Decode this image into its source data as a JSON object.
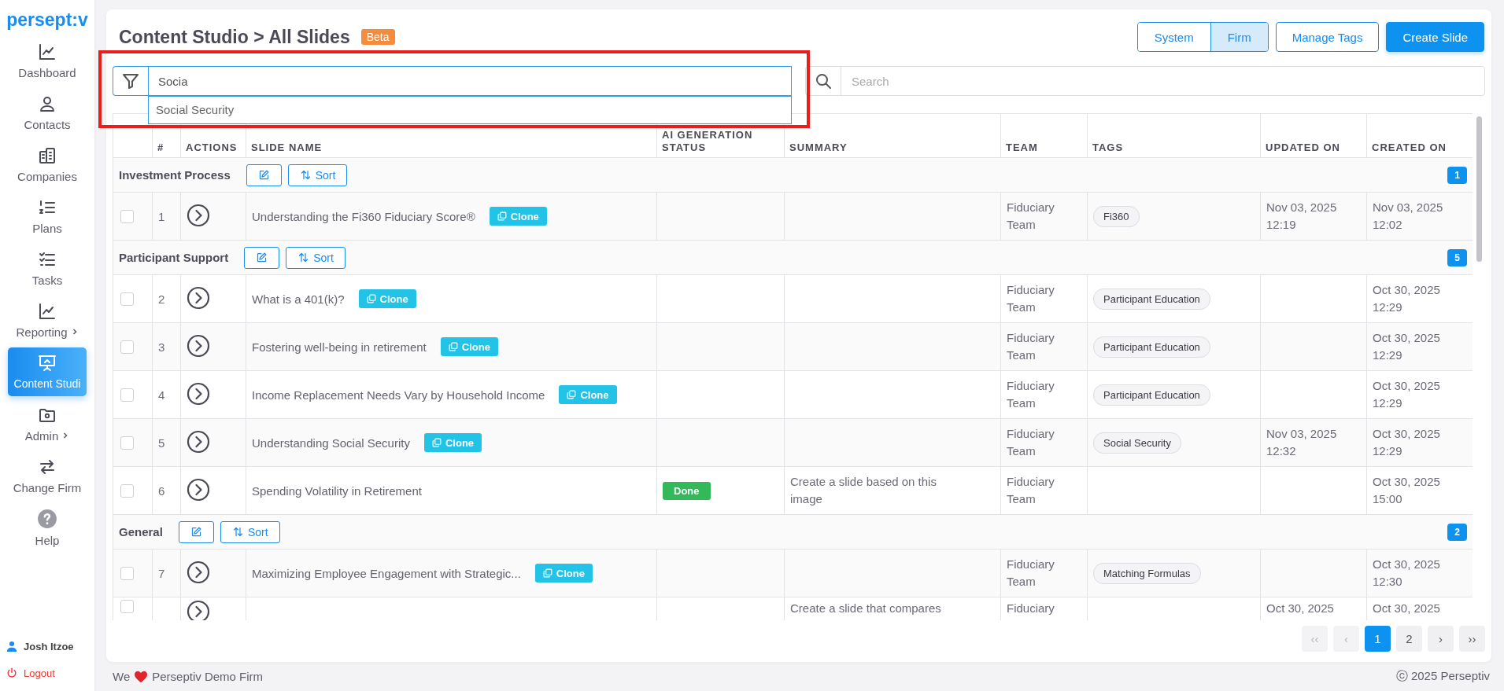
{
  "sidebar": {
    "logo": "persept:v",
    "items": [
      {
        "label": "Dashboard",
        "selected": false,
        "submenu": false
      },
      {
        "label": "Contacts",
        "selected": false,
        "submenu": false
      },
      {
        "label": "Companies",
        "selected": false,
        "submenu": false
      },
      {
        "label": "Plans",
        "selected": false,
        "submenu": false
      },
      {
        "label": "Tasks",
        "selected": false,
        "submenu": false
      },
      {
        "label": "Reporting",
        "selected": false,
        "submenu": true
      },
      {
        "label": "Content Studi",
        "selected": true,
        "submenu": false
      },
      {
        "label": "Admin",
        "selected": false,
        "submenu": true
      },
      {
        "label": "Change Firm",
        "selected": false,
        "submenu": false
      },
      {
        "label": "Help",
        "selected": false,
        "submenu": false
      }
    ],
    "user": "Josh Itzoe",
    "logout": "Logout"
  },
  "header": {
    "title": "Content Studio > All Slides",
    "badge": "Beta",
    "scope_toggle": [
      {
        "label": "System",
        "selected": false
      },
      {
        "label": "Firm",
        "selected": true
      }
    ],
    "buttons": [
      {
        "label": "Manage Tags",
        "kind": "outline"
      },
      {
        "label": "Create Slide",
        "kind": "primary"
      }
    ]
  },
  "filter": {
    "value": "Socia",
    "suggestions": [
      "Social Security"
    ]
  },
  "highlight_box": true,
  "search": {
    "placeholder": "Search"
  },
  "table": {
    "columns": [
      "#",
      "ACTIONS",
      "SLIDE NAME",
      "AI GENERATION STATUS",
      "SUMMARY",
      "TEAM",
      "TAGS",
      "UPDATED ON",
      "CREATED ON"
    ],
    "groups": [
      {
        "name": "Investment Process",
        "sort_label": "Sort",
        "count": "1",
        "rows": [
          {
            "checked": false,
            "number": "1",
            "name": "Understanding the Fi360 Fiduciary Score®",
            "clone": "Clone",
            "team": "Fiduciary Team",
            "tag": "Fi360",
            "updated": "Nov 03, 2025 12:19",
            "created": "Nov 03, 2025 12:02"
          }
        ]
      },
      {
        "name": "Participant Support",
        "sort_label": "Sort",
        "count": "5",
        "rows": [
          {
            "checked": false,
            "number": "2",
            "name": "What is a 401(k)?",
            "clone": "Clone",
            "team": "Fiduciary Team",
            "tag": "Participant Education",
            "created": "Oct 30, 2025 12:29"
          },
          {
            "checked": false,
            "number": "3",
            "name": "Fostering well-being in retirement",
            "clone": "Clone",
            "team": "Fiduciary Team",
            "tag": "Participant Education",
            "created": "Oct 30, 2025 12:29"
          },
          {
            "checked": false,
            "number": "4",
            "name": "Income Replacement Needs Vary by Household Income",
            "clone": "Clone",
            "team": "Fiduciary Team",
            "tag": "Participant Education",
            "created": "Oct 30, 2025 12:29"
          },
          {
            "checked": false,
            "number": "5",
            "name": "Understanding Social Security",
            "clone": "Clone",
            "team": "Fiduciary Team",
            "tag": "Social Security",
            "updated": "Nov 03, 2025 12:32",
            "created": "Oct 30, 2025 12:29"
          },
          {
            "checked": false,
            "number": "6",
            "name": "Spending Volatility in Retirement",
            "status": "Done",
            "summary": "Create a slide based on this image",
            "team": "Fiduciary Team",
            "created": "Oct 30, 2025 15:00"
          }
        ]
      },
      {
        "name": "General",
        "sort_label": "Sort",
        "count": "2",
        "rows": [
          {
            "checked": false,
            "number": "7",
            "name": "Maximizing Employee Engagement with Strategic...",
            "clone": "Clone",
            "team": "Fiduciary Team",
            "tag": "Matching Formulas",
            "created": "Oct 30, 2025 12:30"
          },
          {
            "checked": false,
            "summary": "Create a slide that compares",
            "team": "Fiduciary",
            "updated": "Oct 30, 2025",
            "created": "Oct 30, 2025"
          }
        ]
      }
    ]
  },
  "pagination": [
    {
      "label": "‹‹",
      "selected": false,
      "disabled": true
    },
    {
      "label": "‹",
      "selected": false,
      "disabled": true
    },
    {
      "label": "1",
      "selected": true,
      "disabled": false
    },
    {
      "label": "2",
      "selected": false,
      "disabled": false
    },
    {
      "label": "›",
      "selected": false,
      "disabled": false
    },
    {
      "label": "››",
      "selected": false,
      "disabled": false
    }
  ],
  "footer": {
    "left_start": "We",
    "left_end": "Perseptiv Demo Firm",
    "right": "ⓒ 2025 Perseptiv"
  }
}
